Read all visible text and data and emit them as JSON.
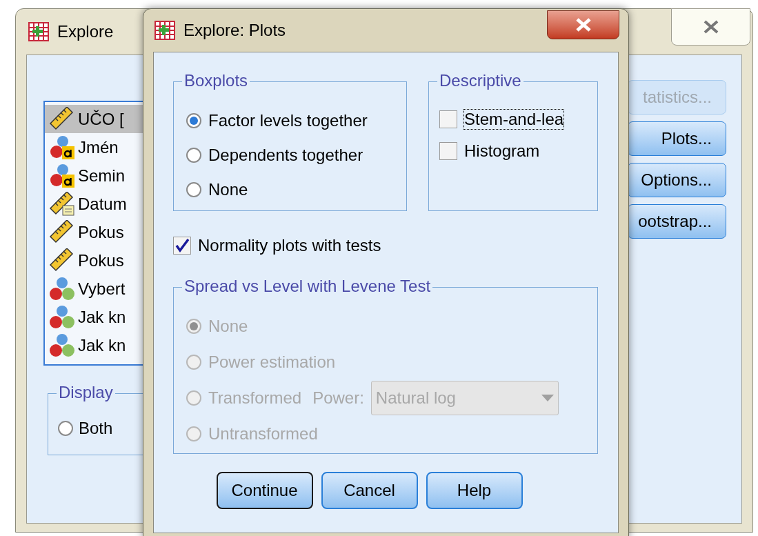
{
  "back_window": {
    "title": "Explore",
    "variables": [
      {
        "label": "UČO [",
        "kind": "scale",
        "selected": true
      },
      {
        "label": "Jmén",
        "kind": "string",
        "selected": false
      },
      {
        "label": "Semin",
        "kind": "string",
        "selected": false
      },
      {
        "label": "Datum",
        "kind": "date",
        "selected": false
      },
      {
        "label": "Pokus",
        "kind": "scale",
        "selected": false
      },
      {
        "label": "Pokus",
        "kind": "scale",
        "selected": false
      },
      {
        "label": "Vybert",
        "kind": "nominal",
        "selected": false
      },
      {
        "label": "Jak kn",
        "kind": "nominal",
        "selected": false
      },
      {
        "label": "Jak kn",
        "kind": "nominal",
        "selected": false
      }
    ],
    "display": {
      "title": "Display",
      "options": [
        {
          "label": "Both",
          "selected": false
        }
      ]
    },
    "buttons": [
      {
        "label": "tatistics...",
        "disabled": true
      },
      {
        "label": "Plots...",
        "disabled": false
      },
      {
        "label": "Options...",
        "disabled": false
      },
      {
        "label": "ootstrap...",
        "disabled": false
      }
    ]
  },
  "dialog": {
    "title": "Explore: Plots",
    "boxplots": {
      "title": "Boxplots",
      "options": [
        {
          "label": "Factor levels together",
          "selected": true
        },
        {
          "label": "Dependents together",
          "selected": false
        },
        {
          "label": "None",
          "selected": false
        }
      ]
    },
    "descriptive": {
      "title": "Descriptive",
      "options": [
        {
          "label": "Stem-and-lea",
          "checked": false,
          "focused": true
        },
        {
          "label": "Histogram",
          "checked": false,
          "focused": false
        }
      ]
    },
    "normality": {
      "label": "Normality plots with tests",
      "checked": true
    },
    "spread": {
      "title": "Spread vs Level with Levene Test",
      "disabled": true,
      "options": [
        {
          "label": "None",
          "selected": true
        },
        {
          "label": "Power estimation",
          "selected": false
        },
        {
          "label": "Transformed",
          "selected": false
        },
        {
          "label": "Untransformed",
          "selected": false
        }
      ],
      "power": {
        "label": "Power:",
        "value": "Natural log"
      }
    },
    "buttons": [
      {
        "label": "Continue",
        "default": true
      },
      {
        "label": "Cancel",
        "default": false
      },
      {
        "label": "Help",
        "default": false
      }
    ]
  }
}
